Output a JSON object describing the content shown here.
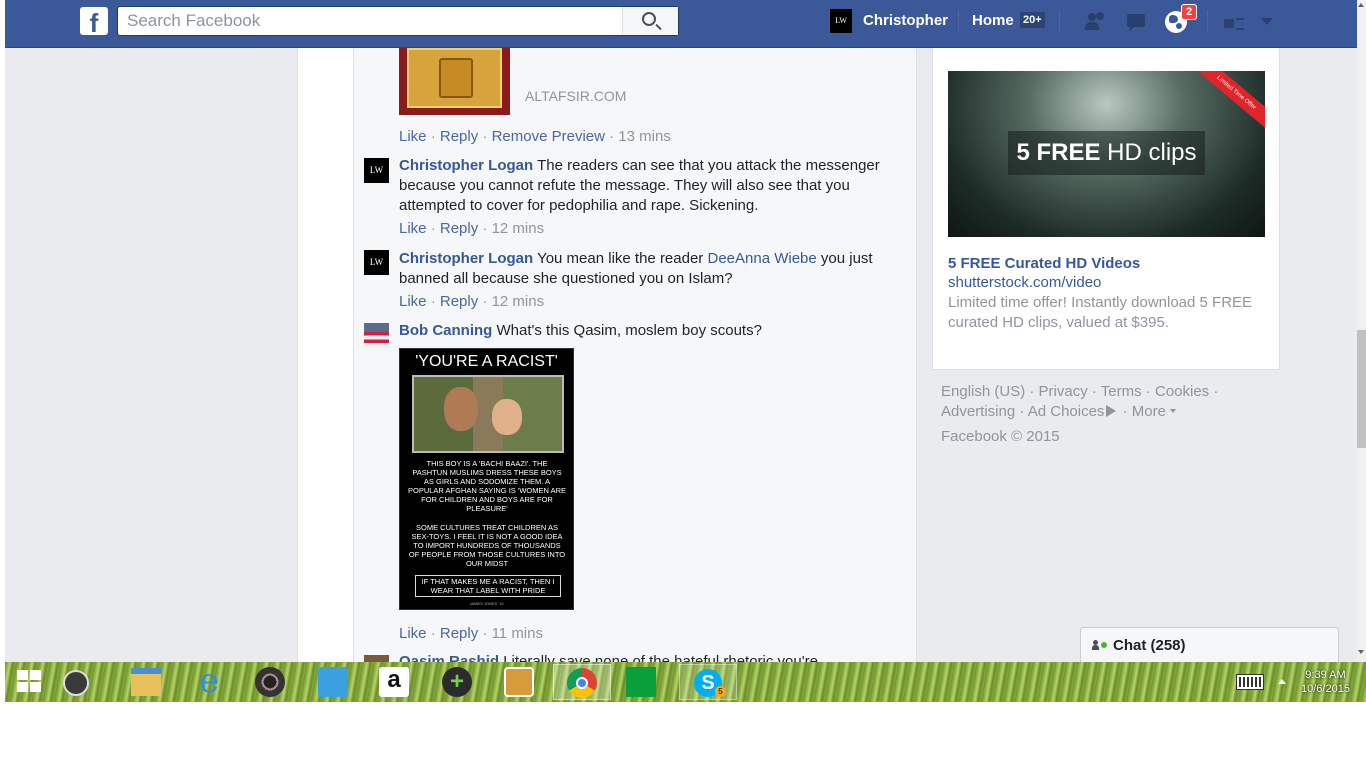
{
  "topbar": {
    "logo": "f",
    "search_placeholder": "Search Facebook",
    "profile_initials": "LW",
    "profile_name": "Christopher",
    "home_label": "Home",
    "home_count": "20+",
    "notification_count": "2"
  },
  "feed": {
    "link_preview": {
      "domain": "ALTAFSIR.COM",
      "actions": {
        "like": "Like",
        "reply": "Reply",
        "remove_preview": "Remove Preview",
        "time": "13 mins"
      }
    },
    "comments": [
      {
        "author": "Christopher Logan",
        "avatar_initials": "LW",
        "text": "The readers can see that you attack the messenger because you cannot refute the message. They will also see that you attempted to cover for pedophilia and rape. Sickening.",
        "like": "Like",
        "reply": "Reply",
        "time": "12 mins"
      },
      {
        "author": "Christopher Logan",
        "avatar_initials": "LW",
        "text_before": "You mean like the reader",
        "mention": "DeeAnna Wiebe",
        "text_after": "you just banned all because she questioned you on Islam?",
        "like": "Like",
        "reply": "Reply",
        "time": "12 mins"
      },
      {
        "author": "Bob Canning",
        "text": "What's this Qasim, moslem boy scouts?",
        "meme": {
          "title": "'YOU'RE A RACIST'",
          "body1": "THIS BOY IS A 'BACHI BAAZI'. THE PASHTUN MUSLIMS DRESS THESE BOYS AS GIRLS AND SODOMIZE THEM. A POPULAR AFGHAN SAYING IS 'WOMEN ARE FOR CHILDREN AND BOYS ARE FOR PLEASURE'",
          "body2": "SOME CULTURES TREAT CHILDREN AS SEX-TOYS. I FEEL IT IS NOT A GOOD IDEA TO IMPORT HUNDREDS OF THOUSANDS OF PEOPLE FROM THOSE CULTURES INTO OUR MIDST",
          "footer": "IF THAT MAKES ME A RACIST, THEN I WEAR THAT LABEL WITH PRIDE",
          "credit": "JAMES JONES '15"
        },
        "like": "Like",
        "reply": "Reply",
        "time": "11 mins"
      },
      {
        "author": "Qasim Rashid",
        "text": "Literally save none of the hateful rhetoric you're"
      }
    ]
  },
  "ad": {
    "ribbon": "Limited Time Offer",
    "overlay_bold": "5 FREE",
    "overlay_rest": " HD clips",
    "title": "5 FREE Curated HD Videos",
    "domain": "shutterstock.com/video",
    "description": "Limited time offer! Instantly download 5 FREE curated HD clips, valued at $395."
  },
  "footer": {
    "links": [
      "English (US)",
      "Privacy",
      "Terms",
      "Cookies",
      "Advertising",
      "Ad Choices",
      "More"
    ],
    "copyright": "Facebook © 2015"
  },
  "chat": {
    "label": "Chat (258)"
  },
  "taskbar": {
    "time": "9:39 AM",
    "date": "10/6/2015",
    "skype_badge": "5",
    "amazon_glyph": "a"
  },
  "colors": {
    "facebook_blue": "#3b5998",
    "link_blue": "#365899",
    "meta_gray": "#90949c",
    "notification_red": "#fa3e3e",
    "online_green": "#42b72a"
  }
}
